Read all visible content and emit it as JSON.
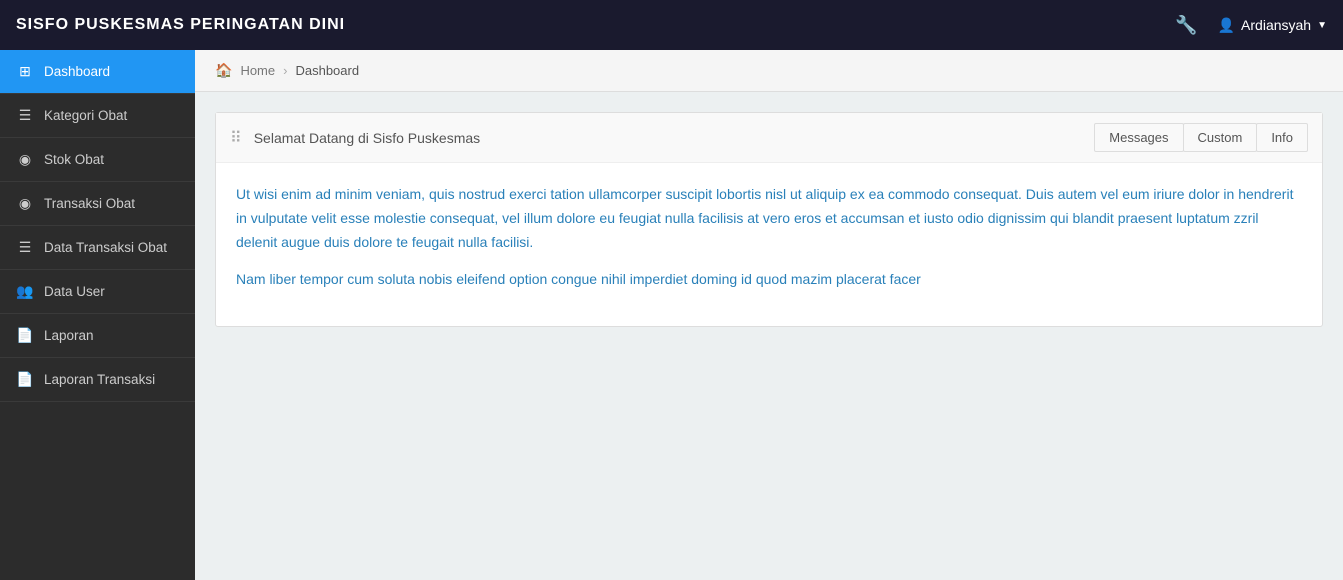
{
  "navbar": {
    "brand": "SISFO PUSKESMAS PERINGATAN DINI",
    "user": "Ardiansyah"
  },
  "breadcrumb": {
    "home": "Home",
    "current": "Dashboard"
  },
  "sidebar": {
    "items": [
      {
        "id": "dashboard",
        "label": "Dashboard",
        "icon": "⊞",
        "active": true
      },
      {
        "id": "kategori-obat",
        "label": "Kategori Obat",
        "icon": "☰",
        "active": false
      },
      {
        "id": "stok-obat",
        "label": "Stok Obat",
        "icon": "👁",
        "active": false
      },
      {
        "id": "transaksi-obat",
        "label": "Transaksi Obat",
        "icon": "👁",
        "active": false
      },
      {
        "id": "data-transaksi-obat",
        "label": "Data Transaksi Obat",
        "icon": "☰",
        "active": false
      },
      {
        "id": "data-user",
        "label": "Data User",
        "icon": "👥",
        "active": false
      },
      {
        "id": "laporan",
        "label": "Laporan",
        "icon": "📄",
        "active": false
      },
      {
        "id": "laporan-transaksi",
        "label": "Laporan Transaksi",
        "icon": "📄",
        "active": false
      }
    ]
  },
  "panel": {
    "title": "Selamat Datang di Sisfo Puskesmas",
    "tabs": [
      {
        "id": "messages",
        "label": "Messages"
      },
      {
        "id": "custom",
        "label": "Custom"
      },
      {
        "id": "info",
        "label": "Info"
      }
    ],
    "body": {
      "paragraph1": "Ut wisi enim ad minim veniam, quis nostrud exerci tation ullamcorper suscipit lobortis nisl ut aliquip ex ea commodo consequat. Duis autem vel eum iriure dolor in hendrerit in vulputate velit esse molestie consequat, vel illum dolore eu feugiat nulla facilisis at vero eros et accumsan et iusto odio dignissim qui blandit praesent luptatum zzril delenit augue duis dolore te feugait nulla facilisi.",
      "paragraph2": "Nam liber tempor cum soluta nobis eleifend option congue nihil imperdiet doming id quod mazim placerat facer"
    }
  }
}
